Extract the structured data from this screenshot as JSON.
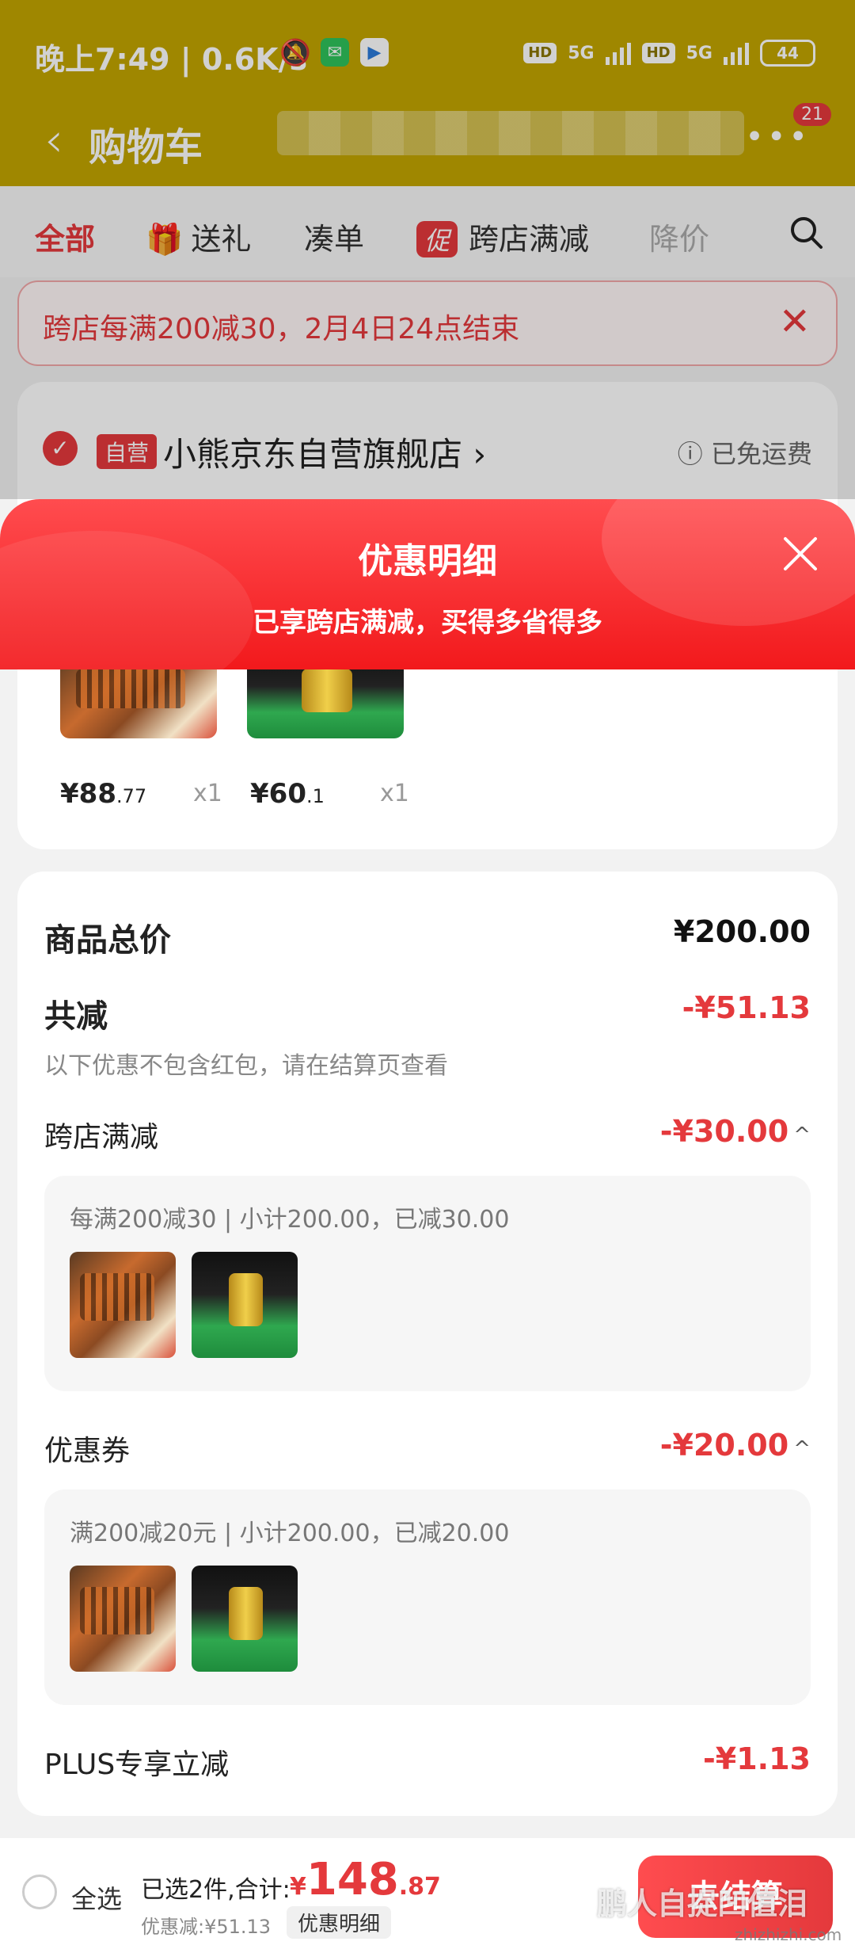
{
  "status_bar": {
    "time": "晚上7:49 | 0.6K/s",
    "hd1": "HD",
    "net1": "5G",
    "hd2": "HD",
    "net2": "5G",
    "battery": "44"
  },
  "nav": {
    "back_icon": "chevron-left-icon",
    "title": "购物车",
    "badge": "21"
  },
  "tabs": {
    "all": "全部",
    "gift": "送礼",
    "combine": "凑单",
    "promo_badge": "促",
    "cross_store": "跨店满减",
    "price_drop": "降价"
  },
  "banner": {
    "text": "跨店每满200减30，2月4日24点结束",
    "close": "✕"
  },
  "store": {
    "self_tag": "自营",
    "name": "小熊京东自营旗舰店",
    "chevron": "›",
    "shipping": "已免运费",
    "items": [
      {
        "price_int": "¥88",
        "price_dec": ".77",
        "qty": "x1"
      },
      {
        "price_int": "¥60",
        "price_dec": ".1",
        "qty": "x1"
      }
    ]
  },
  "promo_sheet": {
    "title": "优惠明细",
    "subtitle": "已享跨店满减，买得多省得多"
  },
  "detail": {
    "total_label": "商品总价",
    "total_value": "¥200.00",
    "discount_label": "共减",
    "discount_value": "-¥51.13",
    "note": "以下优惠不包含红包，请在结算页查看",
    "cross_store_label": "跨店满减",
    "cross_store_value": "-¥30.00",
    "cross_store_rule": "每满200减30 | 小计200.00，已减30.00",
    "coupon_label": "优惠券",
    "coupon_value": "-¥20.00",
    "coupon_rule": "满200减20元 | 小计200.00，已减20.00",
    "plus_label": "PLUS专享立减",
    "plus_value": "-¥1.13",
    "caret": "^"
  },
  "bottom": {
    "select_all": "全选",
    "sum_label": "已选2件,合计:",
    "total_sym": "¥",
    "total_int": "148",
    "total_dec": ".87",
    "saved": "优惠减:¥51.13",
    "detail_btn": "优惠明细",
    "checkout": "去结算"
  },
  "watermark": {
    "text": "鹏人自捉凹值泪",
    "site": "zhizhizhi.com"
  },
  "colors": {
    "brand_red": "#e4393c",
    "status_bar_bg": "#c2a500"
  }
}
